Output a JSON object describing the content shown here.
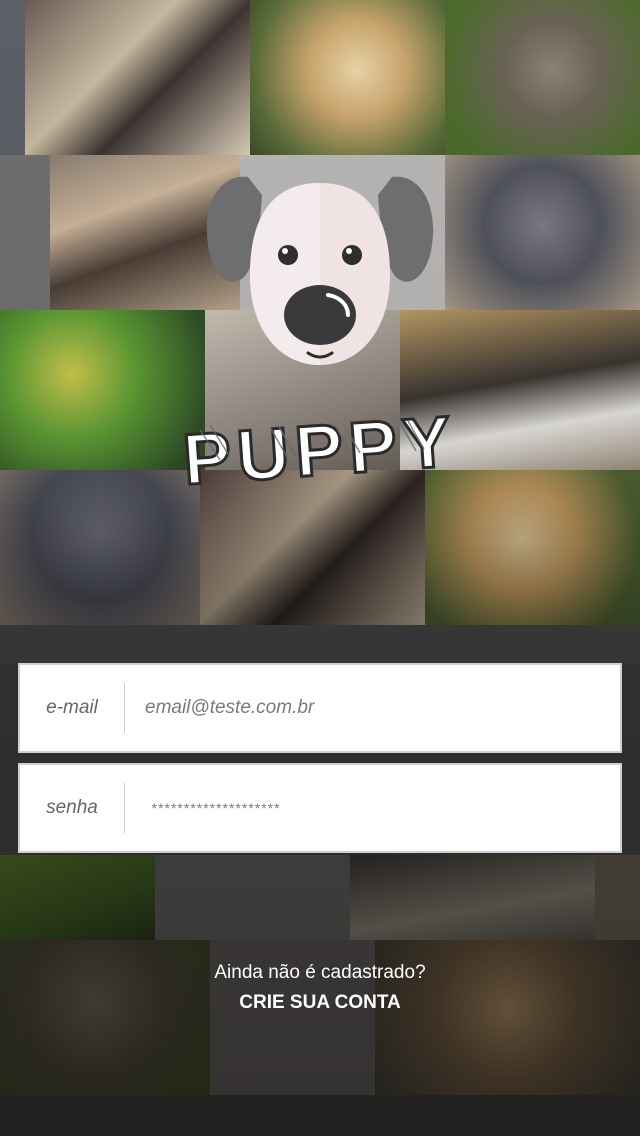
{
  "app": {
    "name": "PUPPY"
  },
  "login": {
    "email_label": "e-mail",
    "email_value": "email@teste.com.br",
    "password_label": "senha",
    "password_value": "********************"
  },
  "signup": {
    "question": "Ainda não é cadastrado?",
    "button_label": "CRIE SUA CONTA"
  },
  "background": {
    "photos": [
      "cats-photo",
      "dog-photo",
      "bird-photo",
      "pets-group-photo",
      "kitten-photo",
      "parrot-photo",
      "sleeping-cat-photo",
      "kitten-photo",
      "cats-photo",
      "dog-photo",
      "parrot-photo",
      "bird-photo",
      "dog-photo"
    ]
  },
  "colors": {
    "field_bg": "#ffffff",
    "text_white": "#ffffff",
    "logo_ear": "#6e6e70",
    "logo_face": "#efe3e4"
  }
}
